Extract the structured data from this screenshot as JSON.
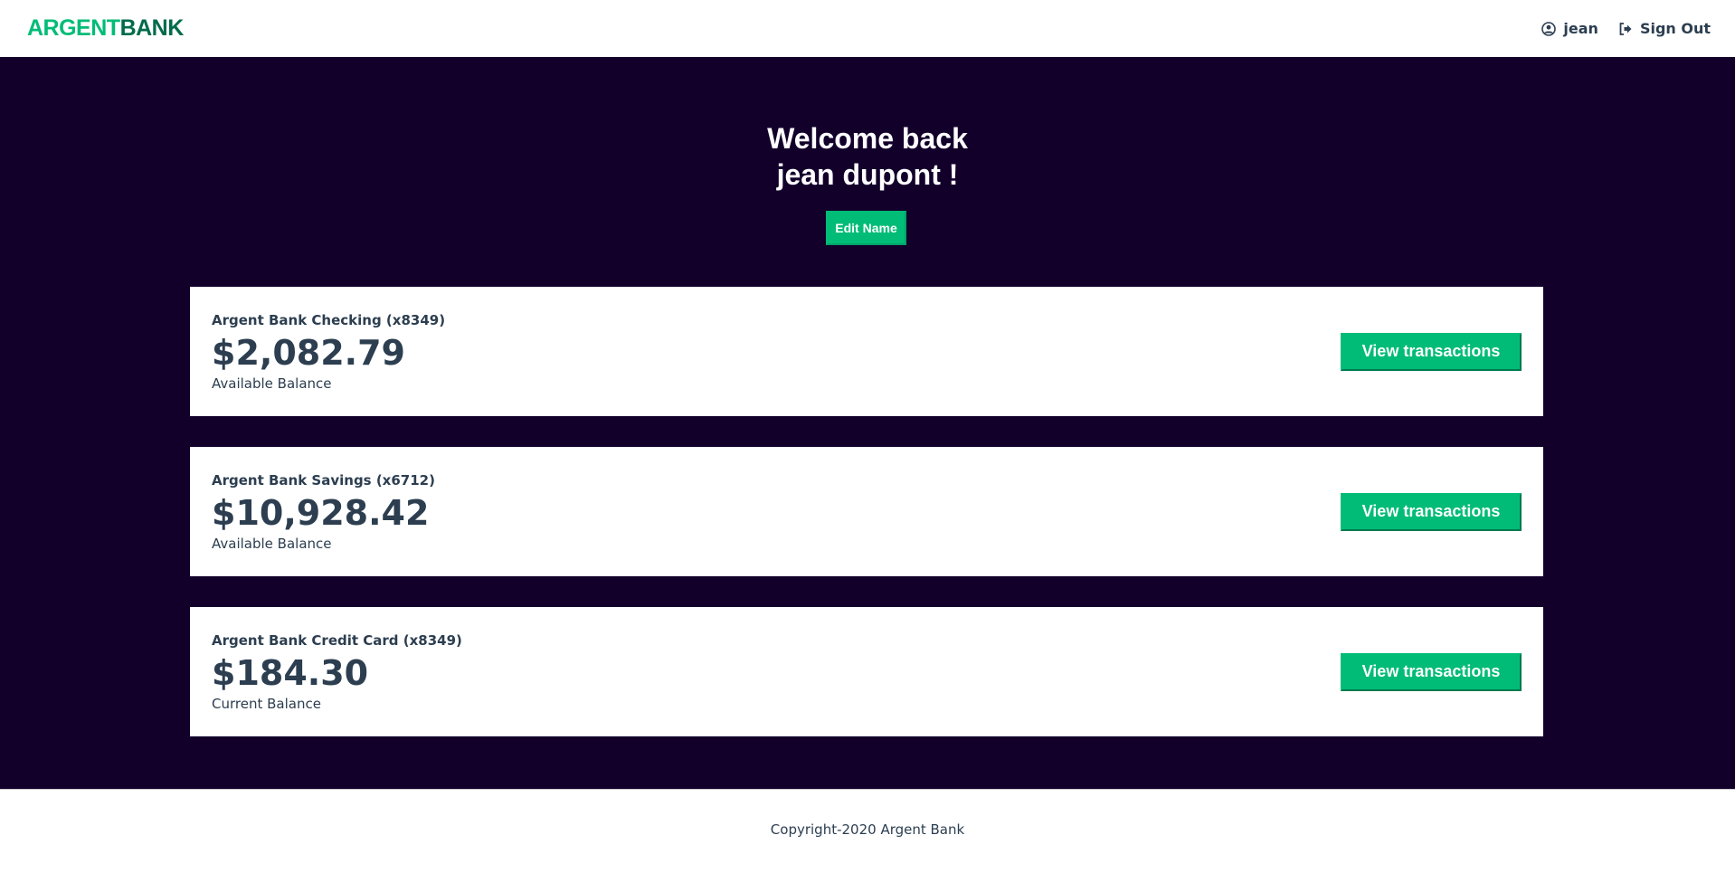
{
  "navbar": {
    "logo": {
      "argent": "ARGENT",
      "bank": "BANK"
    },
    "user_label": "jean",
    "signout_label": "Sign Out"
  },
  "header": {
    "welcome_line1": "Welcome back",
    "welcome_line2": "jean dupont !",
    "edit_button_label": "Edit Name"
  },
  "accounts": [
    {
      "title": "Argent Bank Checking (x8349)",
      "amount": "$2,082.79",
      "description": "Available Balance",
      "button_label": "View transactions"
    },
    {
      "title": "Argent Bank Savings (x6712)",
      "amount": "$10,928.42",
      "description": "Available Balance",
      "button_label": "View transactions"
    },
    {
      "title": "Argent Bank Credit Card (x8349)",
      "amount": "$184.30",
      "description": "Current Balance",
      "button_label": "View transactions"
    }
  ],
  "footer": {
    "text": "Copyright-2020 Argent Bank"
  },
  "colors": {
    "accent": "#00bc77",
    "logo_dark": "#006b4b",
    "background": "#12002b",
    "text": "#2c3e50"
  },
  "icons": {
    "user": "user-circle-icon",
    "signout": "sign-out-icon"
  }
}
